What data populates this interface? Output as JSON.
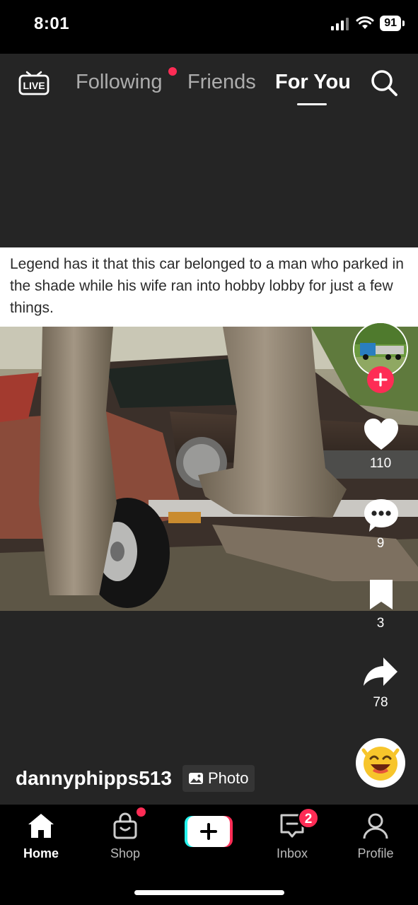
{
  "status_bar": {
    "time": "8:01",
    "battery": "91"
  },
  "top_nav": {
    "live_label": "LIVE",
    "tabs": [
      {
        "label": "Following",
        "has_dot": true
      },
      {
        "label": "Friends"
      },
      {
        "label": "For You",
        "active": true
      }
    ]
  },
  "post": {
    "caption": "Legend has it that this car belonged to a man who parked in the shade while his wife ran into hobby lobby for just a few things.",
    "author": "dannyphipps513",
    "media_type_label": "Photo"
  },
  "actions": {
    "likes": "110",
    "comments": "9",
    "saves": "3",
    "shares": "78"
  },
  "bottom_nav": {
    "items": [
      {
        "label": "Home",
        "active": true
      },
      {
        "label": "Shop"
      },
      {
        "label": ""
      },
      {
        "label": "Inbox",
        "badge": "2"
      },
      {
        "label": "Profile"
      }
    ]
  },
  "colors": {
    "accent": "#fe2c55",
    "cyan": "#25f4ee",
    "feed_bg": "#252525"
  }
}
